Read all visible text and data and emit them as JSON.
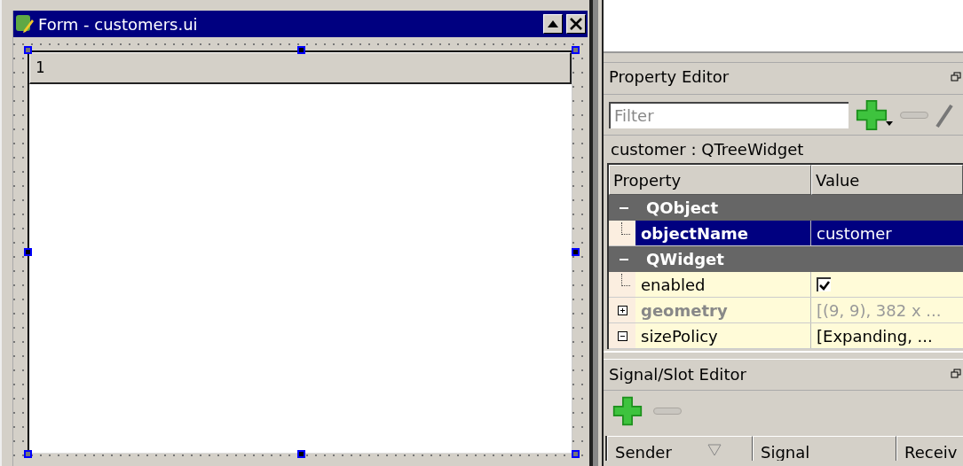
{
  "form_window": {
    "title": "Form - customers.ui",
    "tree_widget": {
      "header": "1",
      "selected": true
    }
  },
  "property_editor": {
    "title": "Property Editor",
    "filter": {
      "placeholder": "Filter"
    },
    "object_label": "customer : QTreeWidget",
    "columns": [
      "Property",
      "Value"
    ],
    "rows": [
      {
        "kind": "group",
        "name": "QObject"
      },
      {
        "kind": "text",
        "name": "objectName",
        "value": "customer",
        "selected": true,
        "modified": true,
        "dimmed": false
      },
      {
        "kind": "group",
        "name": "QWidget"
      },
      {
        "kind": "checkbox",
        "name": "enabled",
        "checked": true,
        "selected": false,
        "modified": false,
        "dimmed": false
      },
      {
        "kind": "text",
        "name": "geometry",
        "value": "[(9, 9), 382 x ...",
        "selected": false,
        "modified": true,
        "expanded": false,
        "dimmed": true
      },
      {
        "kind": "text",
        "name": "sizePolicy",
        "value": "[Expanding, ...",
        "selected": false,
        "modified": false,
        "expanded": true,
        "dimmed": false
      }
    ]
  },
  "signal_slot_editor": {
    "title": "Signal/Slot Editor",
    "columns": [
      "Sender",
      "Signal",
      "Receiv"
    ]
  }
}
